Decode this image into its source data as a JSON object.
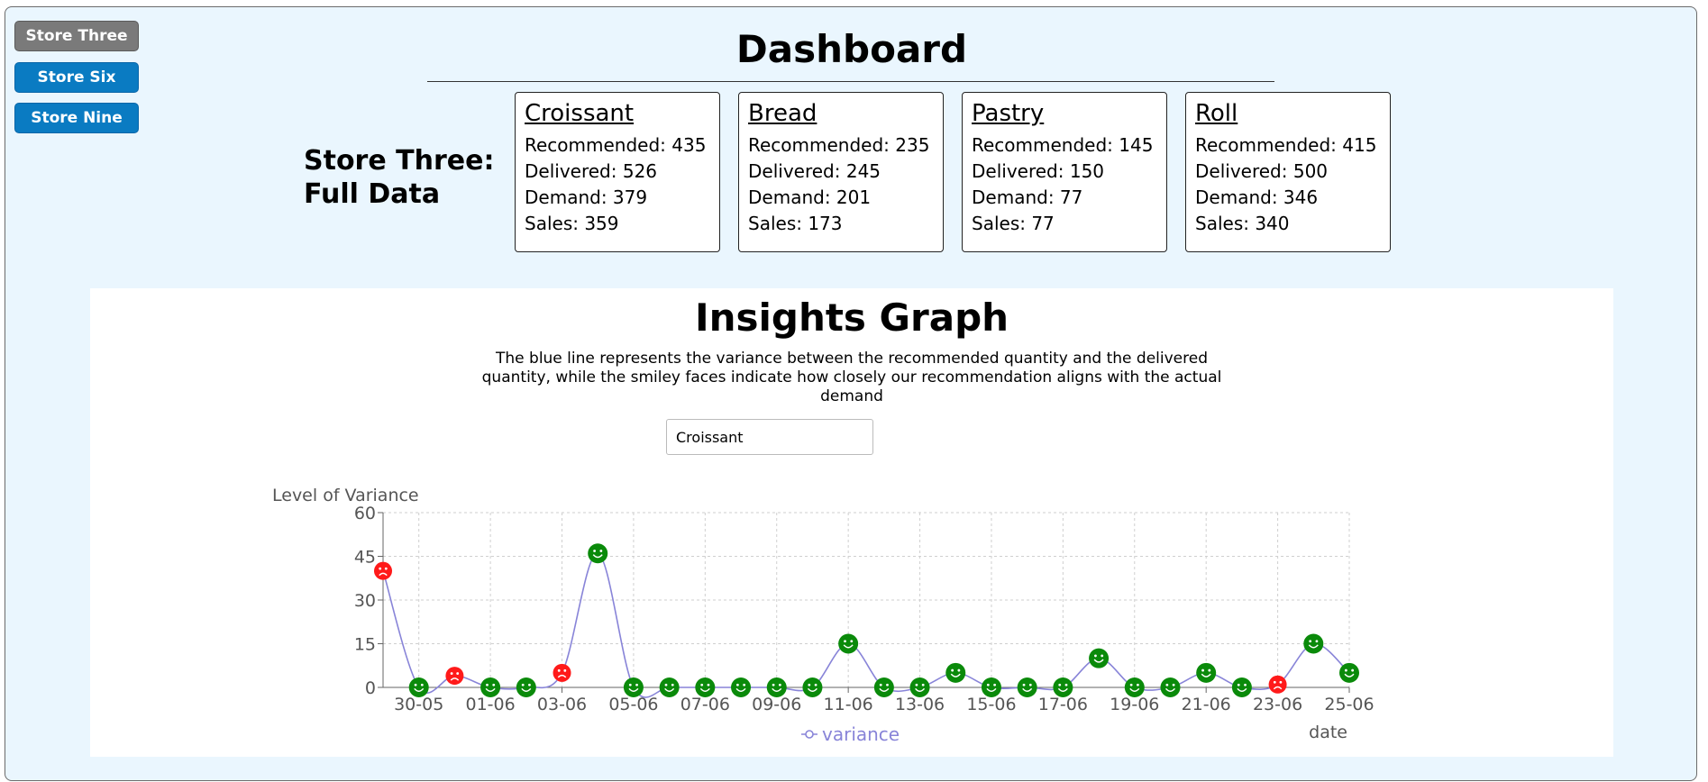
{
  "sidebar": {
    "stores": [
      {
        "label": "Store Three",
        "active": true
      },
      {
        "label": "Store Six",
        "active": false
      },
      {
        "label": "Store Nine",
        "active": false
      }
    ]
  },
  "dashboard": {
    "title": "Dashboard",
    "store_heading_line1": "Store Three:",
    "store_heading_line2": "Full Data",
    "products": [
      {
        "name": "Croissant",
        "recommended": "Recommended: 435",
        "delivered": "Delivered: 526",
        "demand": "Demand: 379",
        "sales": "Sales: 359"
      },
      {
        "name": "Bread",
        "recommended": "Recommended: 235",
        "delivered": "Delivered: 245",
        "demand": "Demand: 201",
        "sales": "Sales: 173"
      },
      {
        "name": "Pastry",
        "recommended": "Recommended: 145",
        "delivered": "Delivered: 150",
        "demand": "Demand: 77",
        "sales": "Sales: 77"
      },
      {
        "name": "Roll",
        "recommended": "Recommended: 415",
        "delivered": "Delivered: 500",
        "demand": "Demand: 346",
        "sales": "Sales: 340"
      }
    ]
  },
  "insights": {
    "title": "Insights Graph",
    "description": "The blue line represents the variance between the recommended quantity and the delivered quantity, while the smiley faces indicate how closely our recommendation aligns with the actual demand",
    "selected_product": "Croissant"
  },
  "colors": {
    "line": "#8884d8",
    "happy": "#0a8a0a",
    "sad": "#ff1a1a",
    "button": "#0a7bc2",
    "button_active": "#7a7a7a"
  },
  "chart_data": {
    "type": "line",
    "ylabel": "Level of Variance",
    "xlabel": "date",
    "legend": "variance",
    "legend_position": "bottom",
    "ylim": [
      0,
      60
    ],
    "yticks": [
      0,
      15,
      30,
      45,
      60
    ],
    "grid": true,
    "xtick_labels": [
      "30-05",
      "01-06",
      "03-06",
      "05-06",
      "07-06",
      "09-06",
      "11-06",
      "13-06",
      "15-06",
      "17-06",
      "19-06",
      "21-06",
      "23-06",
      "25-06"
    ],
    "x": [
      "29-05",
      "30-05",
      "31-05",
      "01-06",
      "02-06",
      "03-06",
      "04-06",
      "05-06",
      "06-06",
      "07-06",
      "08-06",
      "09-06",
      "10-06",
      "11-06",
      "12-06",
      "13-06",
      "14-06",
      "15-06",
      "16-06",
      "17-06",
      "18-06",
      "19-06",
      "20-06",
      "21-06",
      "22-06",
      "23-06",
      "24-06",
      "25-06"
    ],
    "series": [
      {
        "name": "variance",
        "values": [
          40,
          0,
          4,
          0,
          0,
          5,
          46,
          0,
          0,
          0,
          0,
          0,
          0,
          15,
          0,
          0,
          5,
          0,
          0,
          0,
          10,
          0,
          0,
          5,
          0,
          1,
          15,
          5
        ],
        "mood": [
          "sad",
          "happy",
          "sad",
          "happy",
          "happy",
          "sad",
          "happy",
          "happy",
          "happy",
          "happy",
          "happy",
          "happy",
          "happy",
          "happy",
          "happy",
          "happy",
          "happy",
          "happy",
          "happy",
          "happy",
          "happy",
          "happy",
          "happy",
          "happy",
          "happy",
          "sad",
          "happy",
          "happy"
        ]
      }
    ]
  }
}
